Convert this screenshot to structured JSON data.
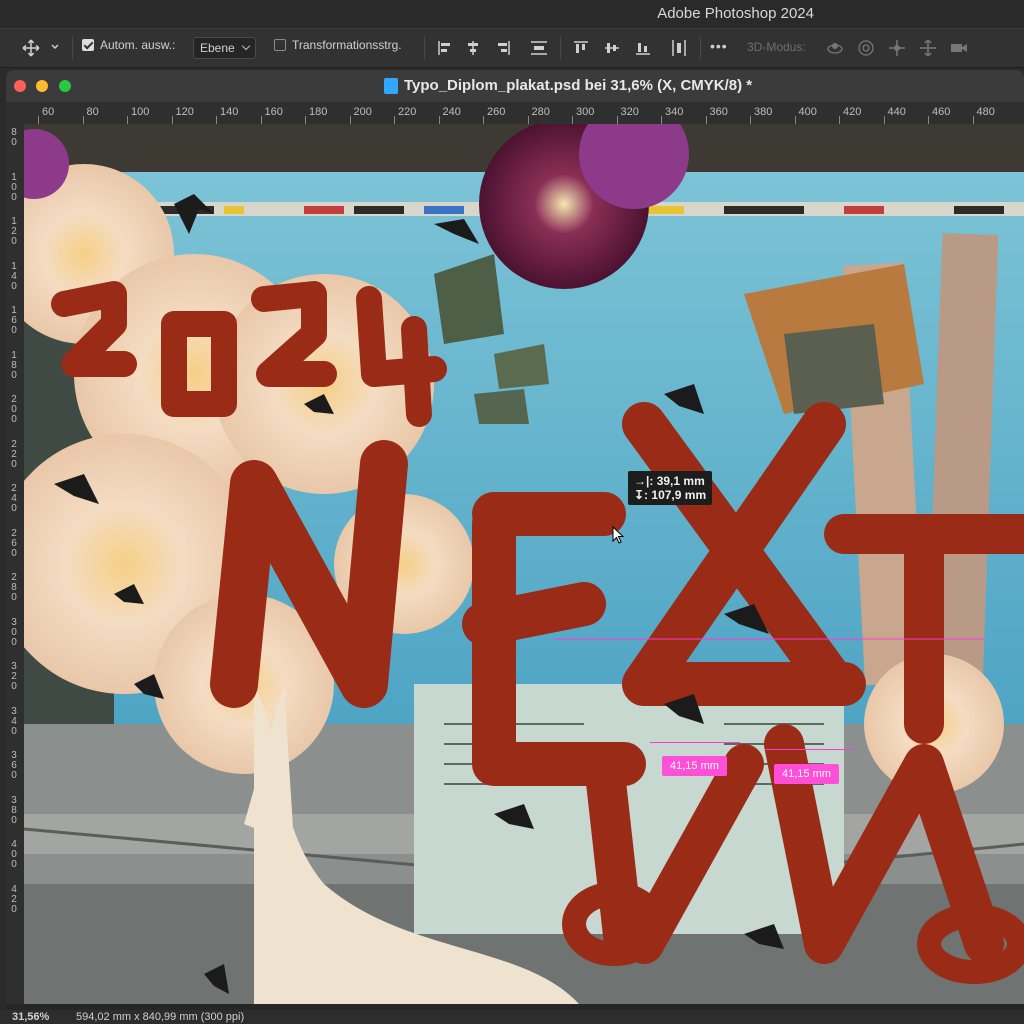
{
  "app": {
    "title": "Adobe Photoshop 2024"
  },
  "options_bar": {
    "auto_select_label": "Autom. ausw.:",
    "auto_select_checked": true,
    "auto_select_target": "Ebene",
    "transform_controls_label": "Transformationsstrg.",
    "transform_controls_checked": false,
    "more_label": "•••",
    "mode_3d_label": "3D-Modus:"
  },
  "document": {
    "tab_title": "Typo_Diplom_plakat.psd bei 31,6% (X, CMYK/8) *"
  },
  "rulers": {
    "horizontal_ticks": [
      "60",
      "80",
      "100",
      "120",
      "140",
      "160",
      "180",
      "200",
      "220",
      "240",
      "260",
      "280",
      "300",
      "320",
      "340",
      "360",
      "380",
      "400",
      "420",
      "440",
      "460",
      "480"
    ],
    "vertical_ticks": [
      "80",
      "100",
      "120",
      "140",
      "160",
      "180",
      "200",
      "220",
      "240",
      "260",
      "280",
      "300",
      "320",
      "340",
      "360",
      "380",
      "400",
      "420"
    ]
  },
  "artwork": {
    "year_text": "2024"
  },
  "measure_tooltip": {
    "width": "39,1 mm",
    "height": "107,9 mm"
  },
  "spacing_labels": [
    "41,15 mm",
    "41,15 mm"
  ],
  "status": {
    "zoom": "31,56%",
    "doc_size": "594,02 mm x 840,99 mm (300 ppi)"
  },
  "colors": {
    "accent_pink": "#ff4fd8",
    "ribbon_red": "#9a2b16",
    "sky_blue": "#5fb3cf",
    "close": "#ff5f57",
    "minimize": "#febc2e",
    "zoom": "#28c840"
  }
}
